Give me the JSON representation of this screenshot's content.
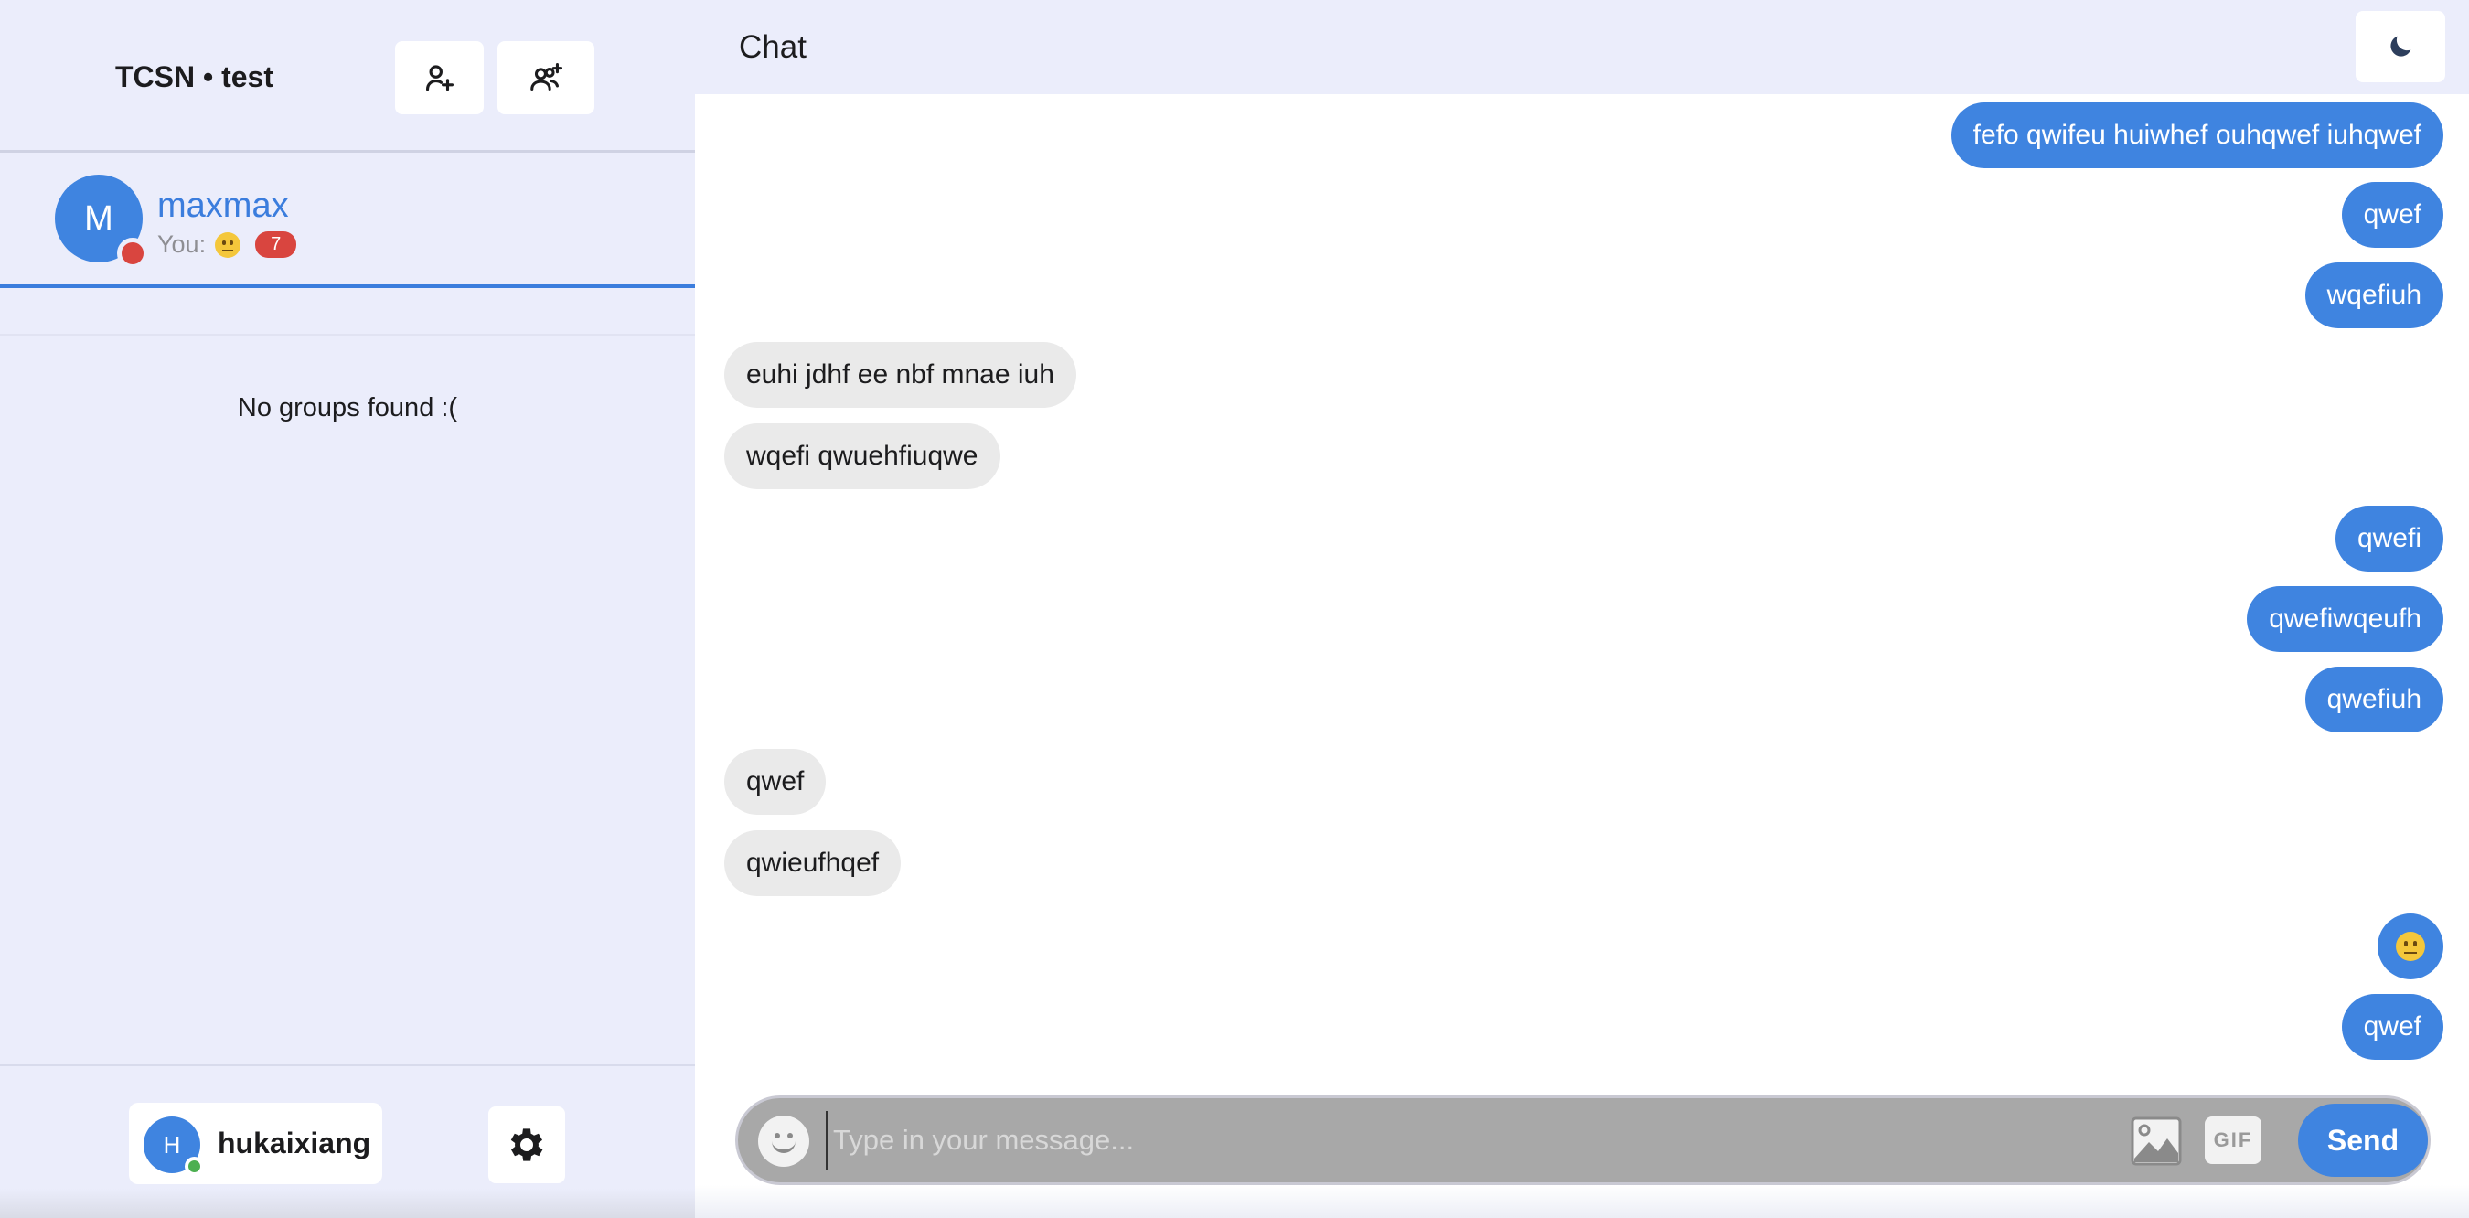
{
  "sidebar": {
    "app_title": "TCSN • test",
    "add_friend_icon": "person-plus-icon",
    "add_group_icon": "people-plus-icon",
    "chats": [
      {
        "avatar_initial": "M",
        "name": "maxmax",
        "status_color": "#d9453f",
        "last_message_prefix": "You:",
        "last_message_emoji": "neutral-face-emoji",
        "unread_count": "7"
      }
    ],
    "no_groups_text": "No groups found :(",
    "current_user": {
      "avatar_initial": "H",
      "username": "hukaixiang",
      "status_color": "#4caf50"
    },
    "settings_icon": "gear-icon"
  },
  "header": {
    "title": "Chat",
    "theme_icon": "moon-icon"
  },
  "messages": [
    {
      "direction": "out",
      "text": "fefo qwifeu huiwhef ouhqwef iuhqwef"
    },
    {
      "direction": "out",
      "text": "qwef"
    },
    {
      "direction": "out",
      "text": "wqefiuh"
    },
    {
      "direction": "in",
      "text": "euhi jdhf ee nbf mnae iuh"
    },
    {
      "direction": "in",
      "text": "wqefi qwuehfiuqwe"
    },
    {
      "direction": "out",
      "text": "qwefi"
    },
    {
      "direction": "out",
      "text": "qwefiwqeufh"
    },
    {
      "direction": "out",
      "text": "qwefiuh"
    },
    {
      "direction": "in",
      "text": "qwef"
    },
    {
      "direction": "in",
      "text": "qwieufhqef"
    },
    {
      "direction": "out",
      "text": "",
      "emoji": "neutral-face-emoji"
    },
    {
      "direction": "out",
      "text": "qwef"
    }
  ],
  "composer": {
    "placeholder": "Type in your message...",
    "value": "",
    "emoji_icon": "smiley-icon",
    "image_icon": "image-icon",
    "gif_label": "GIF",
    "send_label": "Send"
  },
  "colors": {
    "accent": "#3f84e0",
    "sidebar_bg": "#ebedfb",
    "incoming_bubble": "#eaeaea",
    "unread_badge": "#d9453f"
  }
}
